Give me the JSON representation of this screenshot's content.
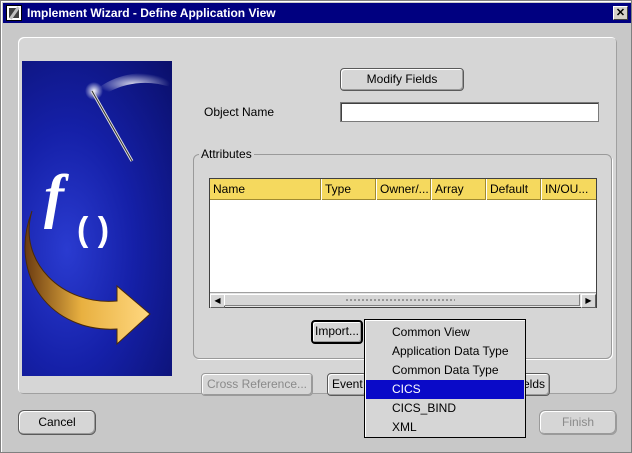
{
  "window": {
    "title": "Implement Wizard - Define Application View",
    "close_glyph": "✕"
  },
  "toolbar": {
    "modify_fields_label": "Modify Fields"
  },
  "form": {
    "object_name_label": "Object Name",
    "object_name_value": ""
  },
  "attributes": {
    "group_label": "Attributes",
    "columns": [
      "Name",
      "Type",
      "Owner/...",
      "Array",
      "Default",
      "IN/OU..."
    ],
    "rows": []
  },
  "buttons": {
    "import_label": "Import...",
    "cross_reference_label": "Cross Reference...",
    "events_label": "Event",
    "fields_label": "elds",
    "cancel_label": "Cancel",
    "finish_label": "Finish"
  },
  "import_menu": {
    "items": [
      {
        "label": "Common View",
        "selected": false
      },
      {
        "label": "Application Data Type",
        "selected": false
      },
      {
        "label": "Common Data Type",
        "selected": false
      },
      {
        "label": "CICS",
        "selected": true
      },
      {
        "label": "CICS_BIND",
        "selected": false
      },
      {
        "label": "XML",
        "selected": false
      }
    ]
  },
  "banner": {
    "function_glyph": "f",
    "parens_glyph": "( )"
  },
  "scrollbar": {
    "left_arrow": "◀",
    "right_arrow": "▶"
  },
  "colors": {
    "title_bar": "#000080",
    "table_header": "#f5d95e",
    "menu_selection": "#0a0ac8",
    "banner": "#1520a8"
  }
}
